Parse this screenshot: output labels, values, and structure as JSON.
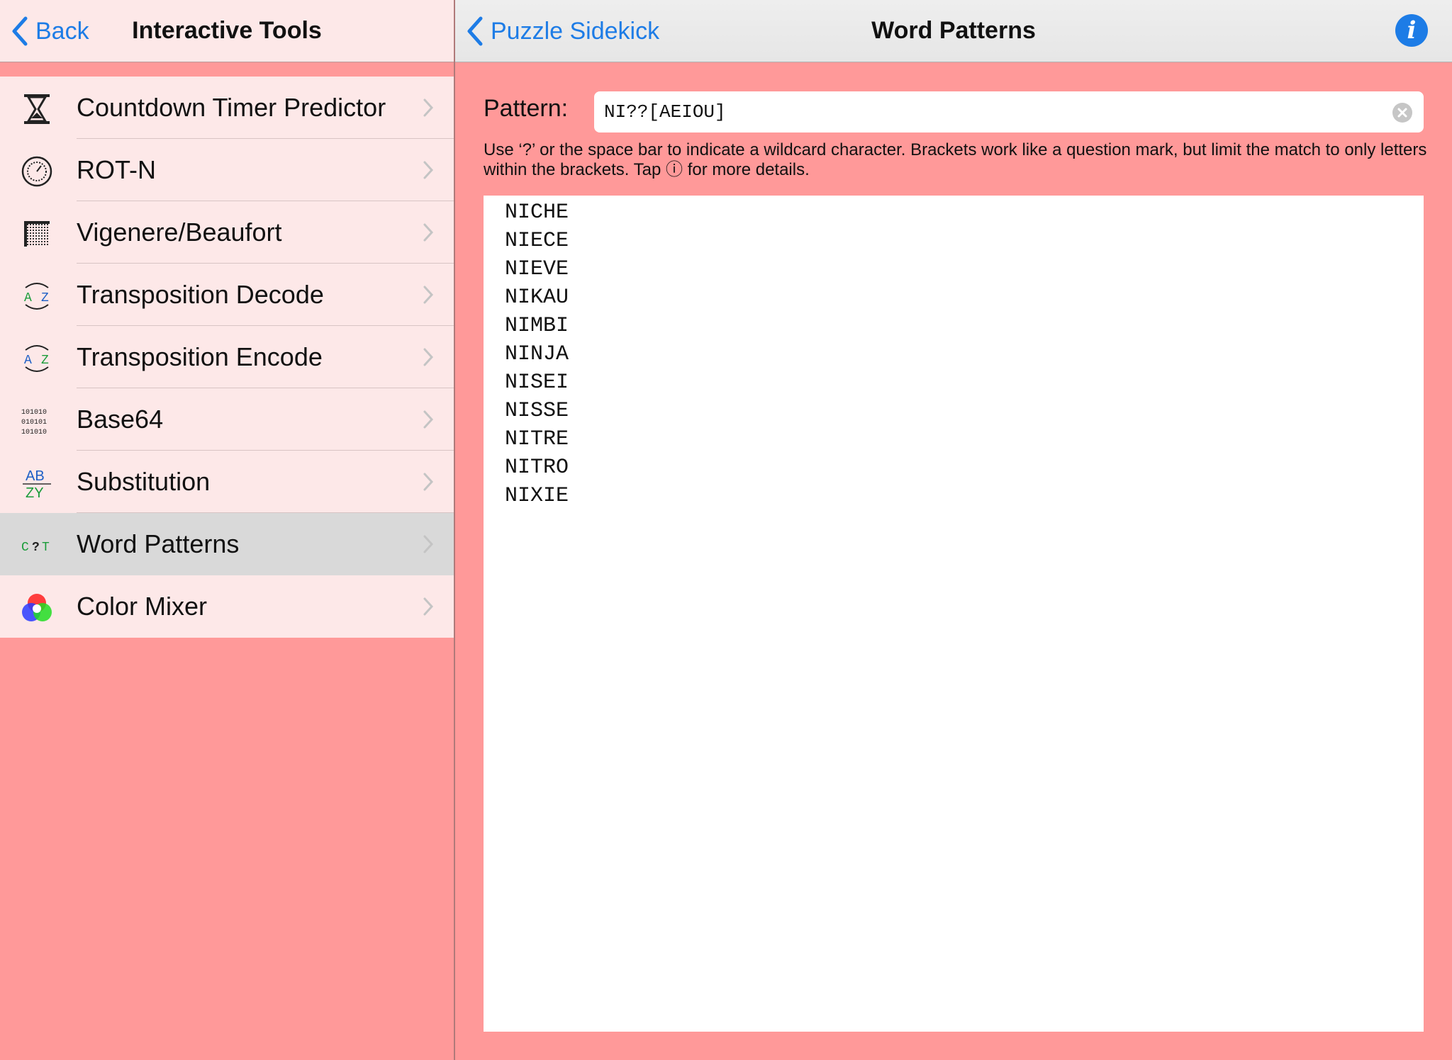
{
  "left": {
    "back_label": "Back",
    "title": "Interactive Tools",
    "items": [
      {
        "label": "Countdown Timer Predictor",
        "icon": "hourglass-icon"
      },
      {
        "label": "ROT-N",
        "icon": "dial-icon"
      },
      {
        "label": "Vigenere/Beaufort",
        "icon": "grid-icon"
      },
      {
        "label": "Transposition Decode",
        "icon": "transposition-decode-icon",
        "icon_text": [
          "A",
          "Z"
        ]
      },
      {
        "label": "Transposition Encode",
        "icon": "transposition-encode-icon",
        "icon_text": [
          "A",
          "Z"
        ]
      },
      {
        "label": "Base64",
        "icon": "binary-icon",
        "icon_text": [
          "101010",
          "010101",
          "101010"
        ]
      },
      {
        "label": "Substitution",
        "icon": "substitution-icon",
        "icon_text": [
          "AB",
          "ZY"
        ]
      },
      {
        "label": "Word Patterns",
        "icon": "word-pattern-icon",
        "icon_text": [
          "C",
          "?",
          "T"
        ],
        "selected": true
      },
      {
        "label": "Color Mixer",
        "icon": "color-mixer-icon"
      }
    ]
  },
  "right": {
    "back_label": "Puzzle Sidekick",
    "title": "Word Patterns",
    "pattern_label": "Pattern:",
    "pattern_value": "NI??[AEIOU]",
    "help_text": "Use ‘?’ or the space bar to indicate a wildcard character. Brackets work like a question mark, but limit the match to only letters within the brackets. Tap ⓘ for more details.",
    "results": [
      "NICHE",
      "NIECE",
      "NIEVE",
      "NIKAU",
      "NIMBI",
      "NINJA",
      "NISEI",
      "NISSE",
      "NITRE",
      "NITRO",
      "NIXIE"
    ]
  },
  "colors": {
    "accent": "#1d7ce6",
    "background": "#ff9999",
    "list_bg": "#fde8e8",
    "selected_row": "#d9d9d9"
  }
}
